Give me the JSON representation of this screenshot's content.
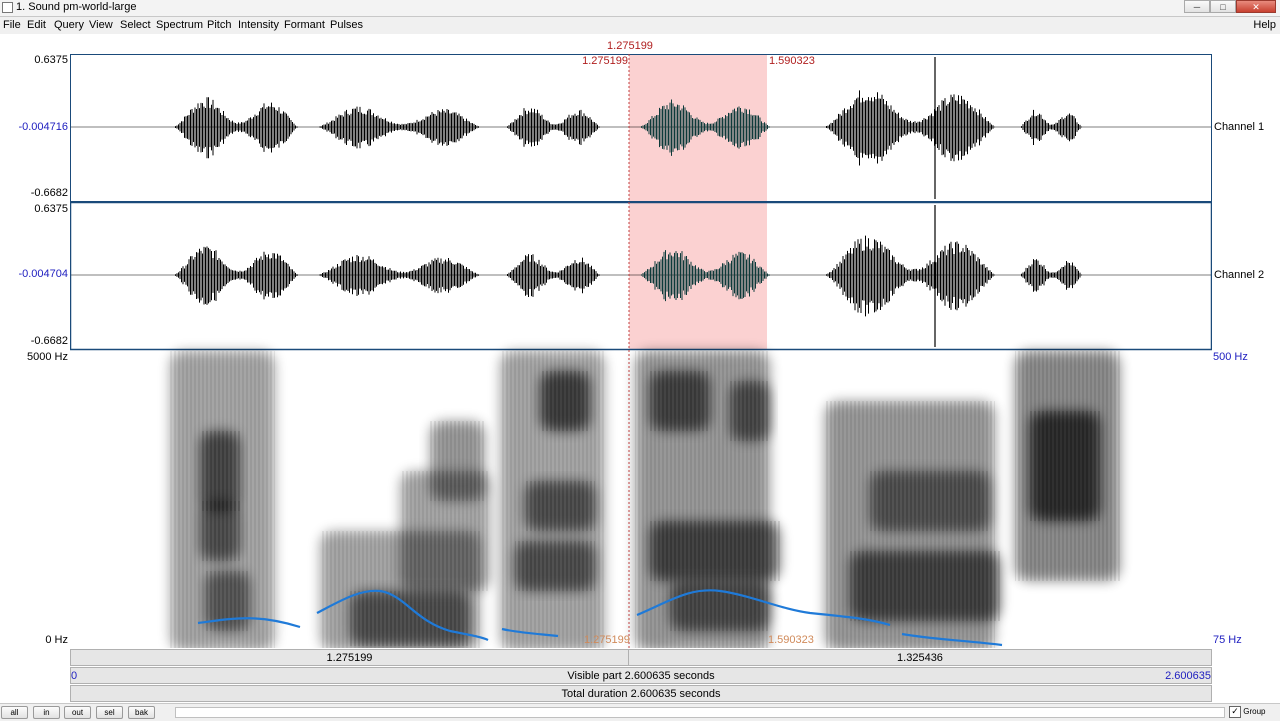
{
  "window": {
    "title": "1. Sound pm-world-large",
    "minimize": "─",
    "maximize": "□",
    "close": "✕"
  },
  "menu": [
    "File",
    "Edit",
    "Query",
    "View",
    "Select",
    "Spectrum",
    "Pitch",
    "Intensity",
    "Formant",
    "Pulses"
  ],
  "help": "Help",
  "cursor": {
    "top_time": "1.275199",
    "sel_start": "1.275199",
    "sel_end": "1.590323"
  },
  "channel1": {
    "ymax": "0.6375",
    "ymid": "-0.004716",
    "ymin": "-0.6682",
    "label": "Channel 1"
  },
  "channel2": {
    "ymax": "0.6375",
    "ymid": "-0.004704",
    "ymin": "-0.6682",
    "label": "Channel 2"
  },
  "spectrogram": {
    "fmax": "5000 Hz",
    "fmin": "0 Hz",
    "pitch_max": "500 Hz",
    "pitch_min": "75 Hz",
    "cursor_bottom": "1.275199",
    "sel_bottom": "1.590323"
  },
  "time_bar": {
    "left_part": "1.275199",
    "right_part": "1.325436"
  },
  "visible": {
    "start": "0",
    "text": "Visible part 2.600635 seconds",
    "end": "2.600635"
  },
  "total": {
    "text": "Total duration 2.600635 seconds"
  },
  "buttons": [
    "all",
    "in",
    "out",
    "sel",
    "bak"
  ],
  "group": {
    "label": "Group",
    "checked": "✓"
  },
  "colors": {
    "selection": "#fbd1d1",
    "pitch": "#1f7ad8",
    "frame": "#1a4a7a",
    "cursor": "#c04040"
  }
}
